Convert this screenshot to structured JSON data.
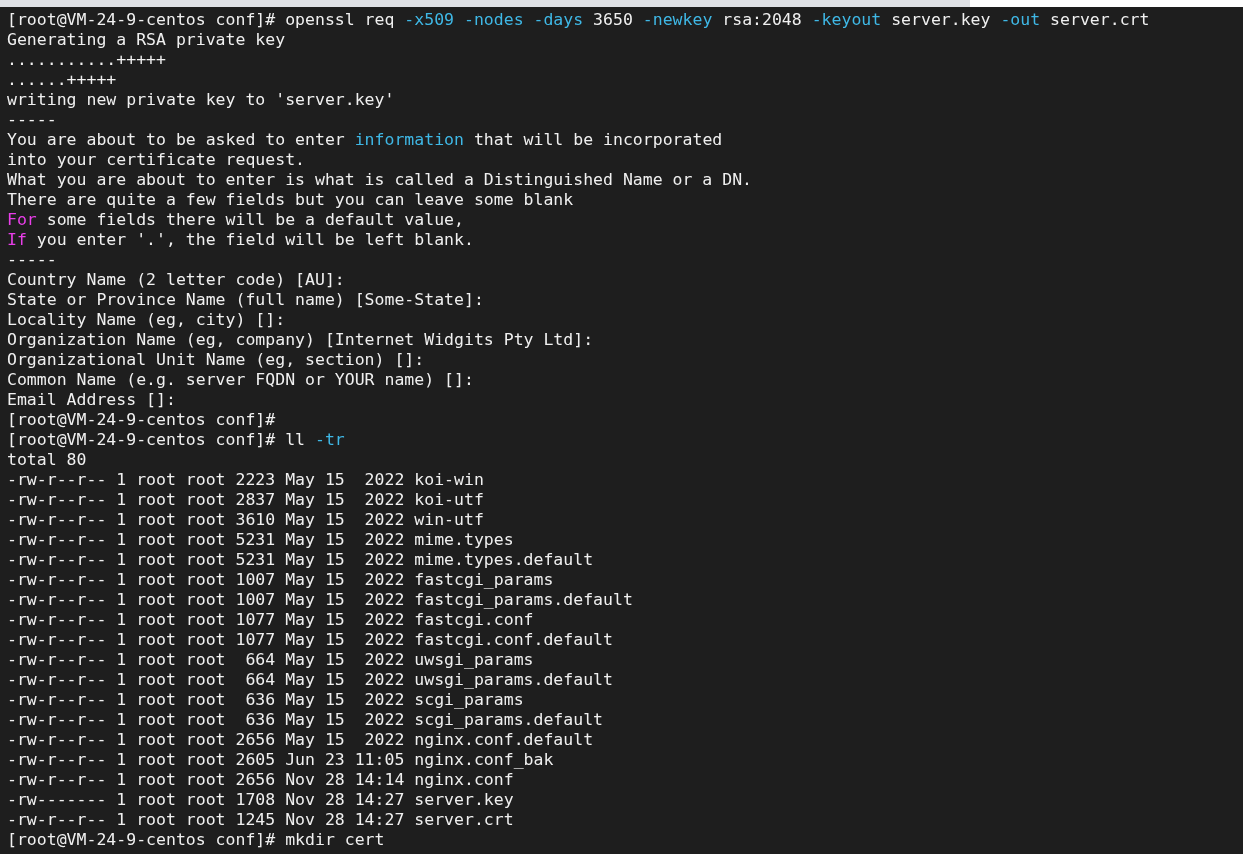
{
  "terminal": {
    "lines": [
      {
        "segments": [
          {
            "text": "[root@VM-24-9-centos conf]# openssl req ",
            "kind": "plain"
          },
          {
            "text": "-x509 -nodes -days",
            "kind": "option"
          },
          {
            "text": " 3650 ",
            "kind": "plain"
          },
          {
            "text": "-newkey",
            "kind": "option"
          },
          {
            "text": " rsa:2048 ",
            "kind": "plain"
          },
          {
            "text": "-keyout",
            "kind": "option"
          },
          {
            "text": " server.key ",
            "kind": "plain"
          },
          {
            "text": "-out",
            "kind": "option"
          },
          {
            "text": " server.crt",
            "kind": "plain"
          }
        ]
      },
      {
        "segments": [
          {
            "text": "Generating a RSA private key",
            "kind": "plain"
          }
        ]
      },
      {
        "segments": [
          {
            "text": "...........+++++",
            "kind": "plain"
          }
        ]
      },
      {
        "segments": [
          {
            "text": "......+++++",
            "kind": "plain"
          }
        ]
      },
      {
        "segments": [
          {
            "text": "writing new private key to 'server.key'",
            "kind": "plain"
          }
        ]
      },
      {
        "segments": [
          {
            "text": "-----",
            "kind": "plain"
          }
        ]
      },
      {
        "segments": [
          {
            "text": "You are about to be asked to enter ",
            "kind": "plain"
          },
          {
            "text": "information",
            "kind": "option"
          },
          {
            "text": " that will be incorporated",
            "kind": "plain"
          }
        ]
      },
      {
        "segments": [
          {
            "text": "into your certificate request.",
            "kind": "plain"
          }
        ]
      },
      {
        "segments": [
          {
            "text": "What you are about to enter is what is called a Distinguished Name or a DN.",
            "kind": "plain"
          }
        ]
      },
      {
        "segments": [
          {
            "text": "There are quite a few fields but you can leave some blank",
            "kind": "plain"
          }
        ]
      },
      {
        "segments": [
          {
            "text": "For",
            "kind": "keyword"
          },
          {
            "text": " some fields there will be a default value,",
            "kind": "plain"
          }
        ]
      },
      {
        "segments": [
          {
            "text": "If",
            "kind": "keyword"
          },
          {
            "text": " you enter '.', the field will be left blank.",
            "kind": "plain"
          }
        ]
      },
      {
        "segments": [
          {
            "text": "-----",
            "kind": "plain"
          }
        ]
      },
      {
        "segments": [
          {
            "text": "Country Name (2 letter code) [AU]:",
            "kind": "plain"
          }
        ]
      },
      {
        "segments": [
          {
            "text": "State or Province Name (full name) [Some-State]:",
            "kind": "plain"
          }
        ]
      },
      {
        "segments": [
          {
            "text": "Locality Name (eg, city) []:",
            "kind": "plain"
          }
        ]
      },
      {
        "segments": [
          {
            "text": "Organization Name (eg, company) [Internet Widgits Pty Ltd]:",
            "kind": "plain"
          }
        ]
      },
      {
        "segments": [
          {
            "text": "Organizational Unit Name (eg, section) []:",
            "kind": "plain"
          }
        ]
      },
      {
        "segments": [
          {
            "text": "Common Name (e.g. server FQDN or YOUR name) []:",
            "kind": "plain"
          }
        ]
      },
      {
        "segments": [
          {
            "text": "Email Address []:",
            "kind": "plain"
          }
        ]
      },
      {
        "segments": [
          {
            "text": "[root@VM-24-9-centos conf]#",
            "kind": "plain"
          }
        ]
      },
      {
        "segments": [
          {
            "text": "[root@VM-24-9-centos conf]# ll ",
            "kind": "plain"
          },
          {
            "text": "-tr",
            "kind": "option"
          }
        ]
      },
      {
        "segments": [
          {
            "text": "total 80",
            "kind": "plain"
          }
        ]
      },
      {
        "segments": [
          {
            "text": "-rw-r--r-- 1 root root 2223 May 15  2022 koi-win",
            "kind": "plain"
          }
        ]
      },
      {
        "segments": [
          {
            "text": "-rw-r--r-- 1 root root 2837 May 15  2022 koi-utf",
            "kind": "plain"
          }
        ]
      },
      {
        "segments": [
          {
            "text": "-rw-r--r-- 1 root root 3610 May 15  2022 win-utf",
            "kind": "plain"
          }
        ]
      },
      {
        "segments": [
          {
            "text": "-rw-r--r-- 1 root root 5231 May 15  2022 mime.types",
            "kind": "plain"
          }
        ]
      },
      {
        "segments": [
          {
            "text": "-rw-r--r-- 1 root root 5231 May 15  2022 mime.types.default",
            "kind": "plain"
          }
        ]
      },
      {
        "segments": [
          {
            "text": "-rw-r--r-- 1 root root 1007 May 15  2022 fastcgi_params",
            "kind": "plain"
          }
        ]
      },
      {
        "segments": [
          {
            "text": "-rw-r--r-- 1 root root 1007 May 15  2022 fastcgi_params.default",
            "kind": "plain"
          }
        ]
      },
      {
        "segments": [
          {
            "text": "-rw-r--r-- 1 root root 1077 May 15  2022 fastcgi.conf",
            "kind": "plain"
          }
        ]
      },
      {
        "segments": [
          {
            "text": "-rw-r--r-- 1 root root 1077 May 15  2022 fastcgi.conf.default",
            "kind": "plain"
          }
        ]
      },
      {
        "segments": [
          {
            "text": "-rw-r--r-- 1 root root  664 May 15  2022 uwsgi_params",
            "kind": "plain"
          }
        ]
      },
      {
        "segments": [
          {
            "text": "-rw-r--r-- 1 root root  664 May 15  2022 uwsgi_params.default",
            "kind": "plain"
          }
        ]
      },
      {
        "segments": [
          {
            "text": "-rw-r--r-- 1 root root  636 May 15  2022 scgi_params",
            "kind": "plain"
          }
        ]
      },
      {
        "segments": [
          {
            "text": "-rw-r--r-- 1 root root  636 May 15  2022 scgi_params.default",
            "kind": "plain"
          }
        ]
      },
      {
        "segments": [
          {
            "text": "-rw-r--r-- 1 root root 2656 May 15  2022 nginx.conf.default",
            "kind": "plain"
          }
        ]
      },
      {
        "segments": [
          {
            "text": "-rw-r--r-- 1 root root 2605 Jun 23 11:05 nginx.conf_bak",
            "kind": "plain"
          }
        ]
      },
      {
        "segments": [
          {
            "text": "-rw-r--r-- 1 root root 2656 Nov 28 14:14 nginx.conf",
            "kind": "plain"
          }
        ]
      },
      {
        "segments": [
          {
            "text": "-rw------- 1 root root 1708 Nov 28 14:27 server.key",
            "kind": "plain"
          }
        ]
      },
      {
        "segments": [
          {
            "text": "-rw-r--r-- 1 root root 1245 Nov 28 14:27 server.crt",
            "kind": "plain"
          }
        ]
      },
      {
        "segments": [
          {
            "text": "[root@VM-24-9-centos conf]# mkdir cert",
            "kind": "plain"
          }
        ]
      }
    ]
  }
}
